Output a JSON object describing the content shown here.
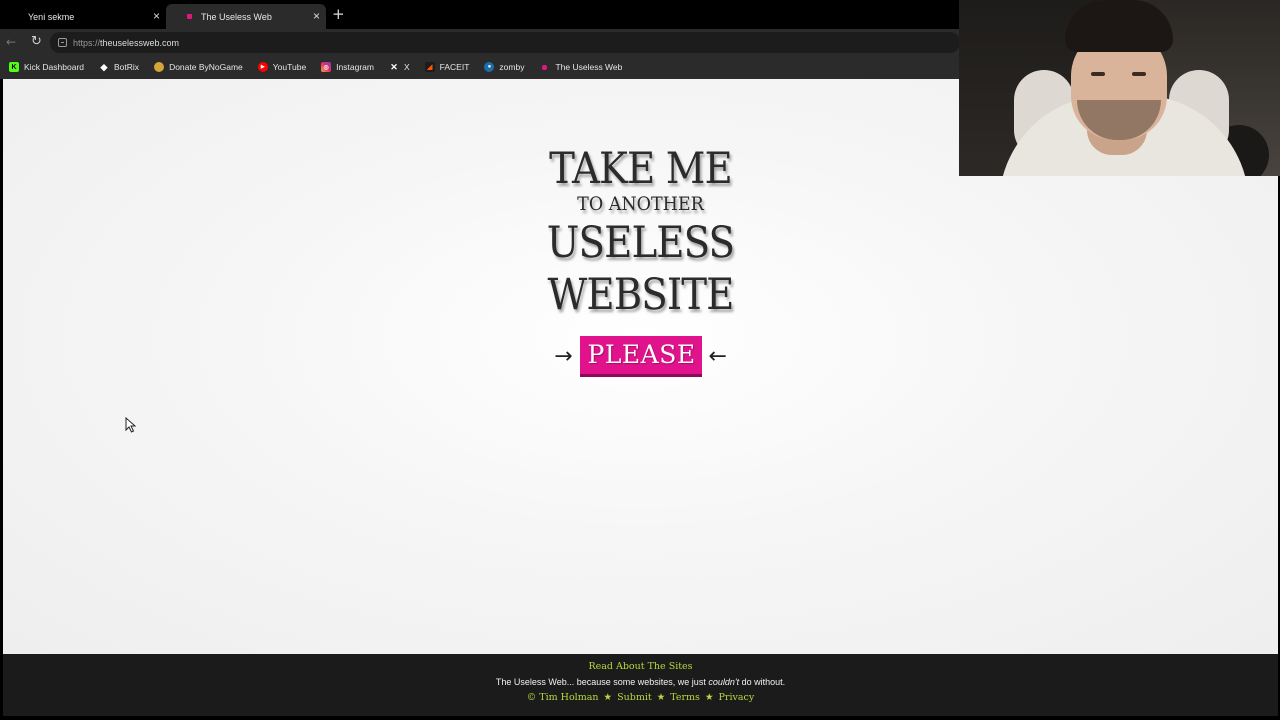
{
  "browser": {
    "tabs": [
      {
        "title": "Yeni sekme",
        "active": false
      },
      {
        "title": "The Useless Web",
        "active": true
      }
    ],
    "new_tab_label": "+",
    "url_scheme": "https://",
    "url_host": "theuselessweb.com",
    "bookmarks": [
      {
        "label": "Kick Dashboard",
        "icon": "kick-icon"
      },
      {
        "label": "BotRix",
        "icon": "botrix-icon"
      },
      {
        "label": "Donate ByNoGame",
        "icon": "donate-icon"
      },
      {
        "label": "YouTube",
        "icon": "youtube-icon"
      },
      {
        "label": "Instagram",
        "icon": "instagram-icon"
      },
      {
        "label": "X",
        "icon": "x-icon"
      },
      {
        "label": "FACEIT",
        "icon": "faceit-icon"
      },
      {
        "label": "zomby",
        "icon": "steam-icon"
      },
      {
        "label": "The Useless Web",
        "icon": "useless-web-icon"
      }
    ]
  },
  "hero": {
    "line1": "TAKE ME",
    "line2": "TO ANOTHER",
    "line3": "USELESS",
    "line4": "WEBSITE",
    "arrow_left": "→",
    "button": "PLEASE",
    "arrow_right": "←"
  },
  "footer": {
    "read_about": "Read About The Sites",
    "tagline_start": "The Useless Web... because some websites, we just ",
    "tagline_em": "couldn't",
    "tagline_end": " do without.",
    "copyright": "© Tim Holman",
    "submit": "Submit",
    "terms": "Terms",
    "privacy": "Privacy",
    "separator": "★"
  },
  "colors": {
    "button_pink": "#e0138c",
    "footer_link_green": "#b6d93d",
    "footer_bg": "#1b1b1b"
  }
}
